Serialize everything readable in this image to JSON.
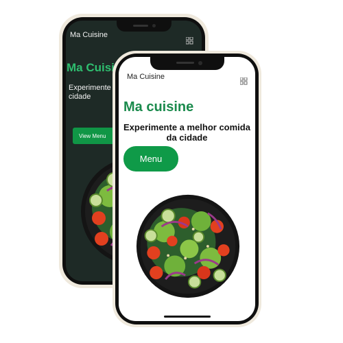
{
  "back_phone": {
    "brand": "Ma Cuisine",
    "hero_title": "Ma Cuisine",
    "subtitle": "Experimente a melhor comida da cidade",
    "button_label": "View Menu",
    "menu_icon": "grid-menu-icon",
    "image": "salad-bowl"
  },
  "front_phone": {
    "brand": "Ma Cuisine",
    "hero_title": "Ma cuisine",
    "subtitle": "Experimente a melhor comida da cidade",
    "button_label": "Menu",
    "menu_icon": "grid-menu-icon",
    "image": "salad-bowl"
  },
  "colors": {
    "accent_green": "#0f9a48",
    "hero_green_dark_theme": "#2fbe6f",
    "hero_green_light_theme": "#1a8a4c",
    "dark_screen_bg": "#1e2a26",
    "phone_frame": "#efe9dd"
  }
}
